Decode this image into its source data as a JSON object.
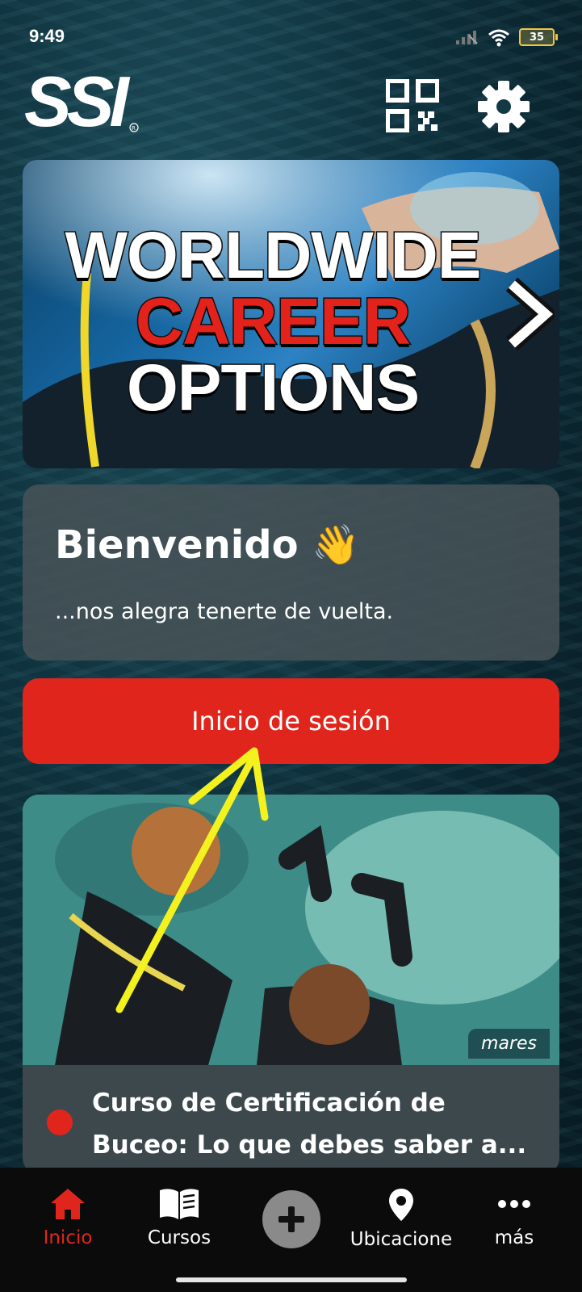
{
  "status": {
    "time": "9:49",
    "battery": "35"
  },
  "header": {
    "logo_text": "SSI"
  },
  "banner": {
    "line1": "WORLDWIDE",
    "line2": "CAREER",
    "line3": "OPTIONS"
  },
  "welcome": {
    "title": "Bienvenido 👋",
    "subtitle": "...nos alegra tenerte de vuelta."
  },
  "login": {
    "label": "Inicio de sesión"
  },
  "article": {
    "brand_tag": "mares",
    "title": "Curso de Certificación de Buceo: Lo que debes saber a..."
  },
  "nav": {
    "items": [
      {
        "label": "Inicio",
        "icon": "home-icon",
        "active": true
      },
      {
        "label": "Cursos",
        "icon": "book-icon"
      },
      {
        "label": "",
        "icon": "plus-icon"
      },
      {
        "label": "Ubicacione",
        "icon": "location-pin-icon"
      },
      {
        "label": "más",
        "icon": "more-dots-icon"
      }
    ]
  },
  "colors": {
    "accent": "#e0261c",
    "nav_bg": "#0b0b0b",
    "card_bg": "#46525a"
  }
}
